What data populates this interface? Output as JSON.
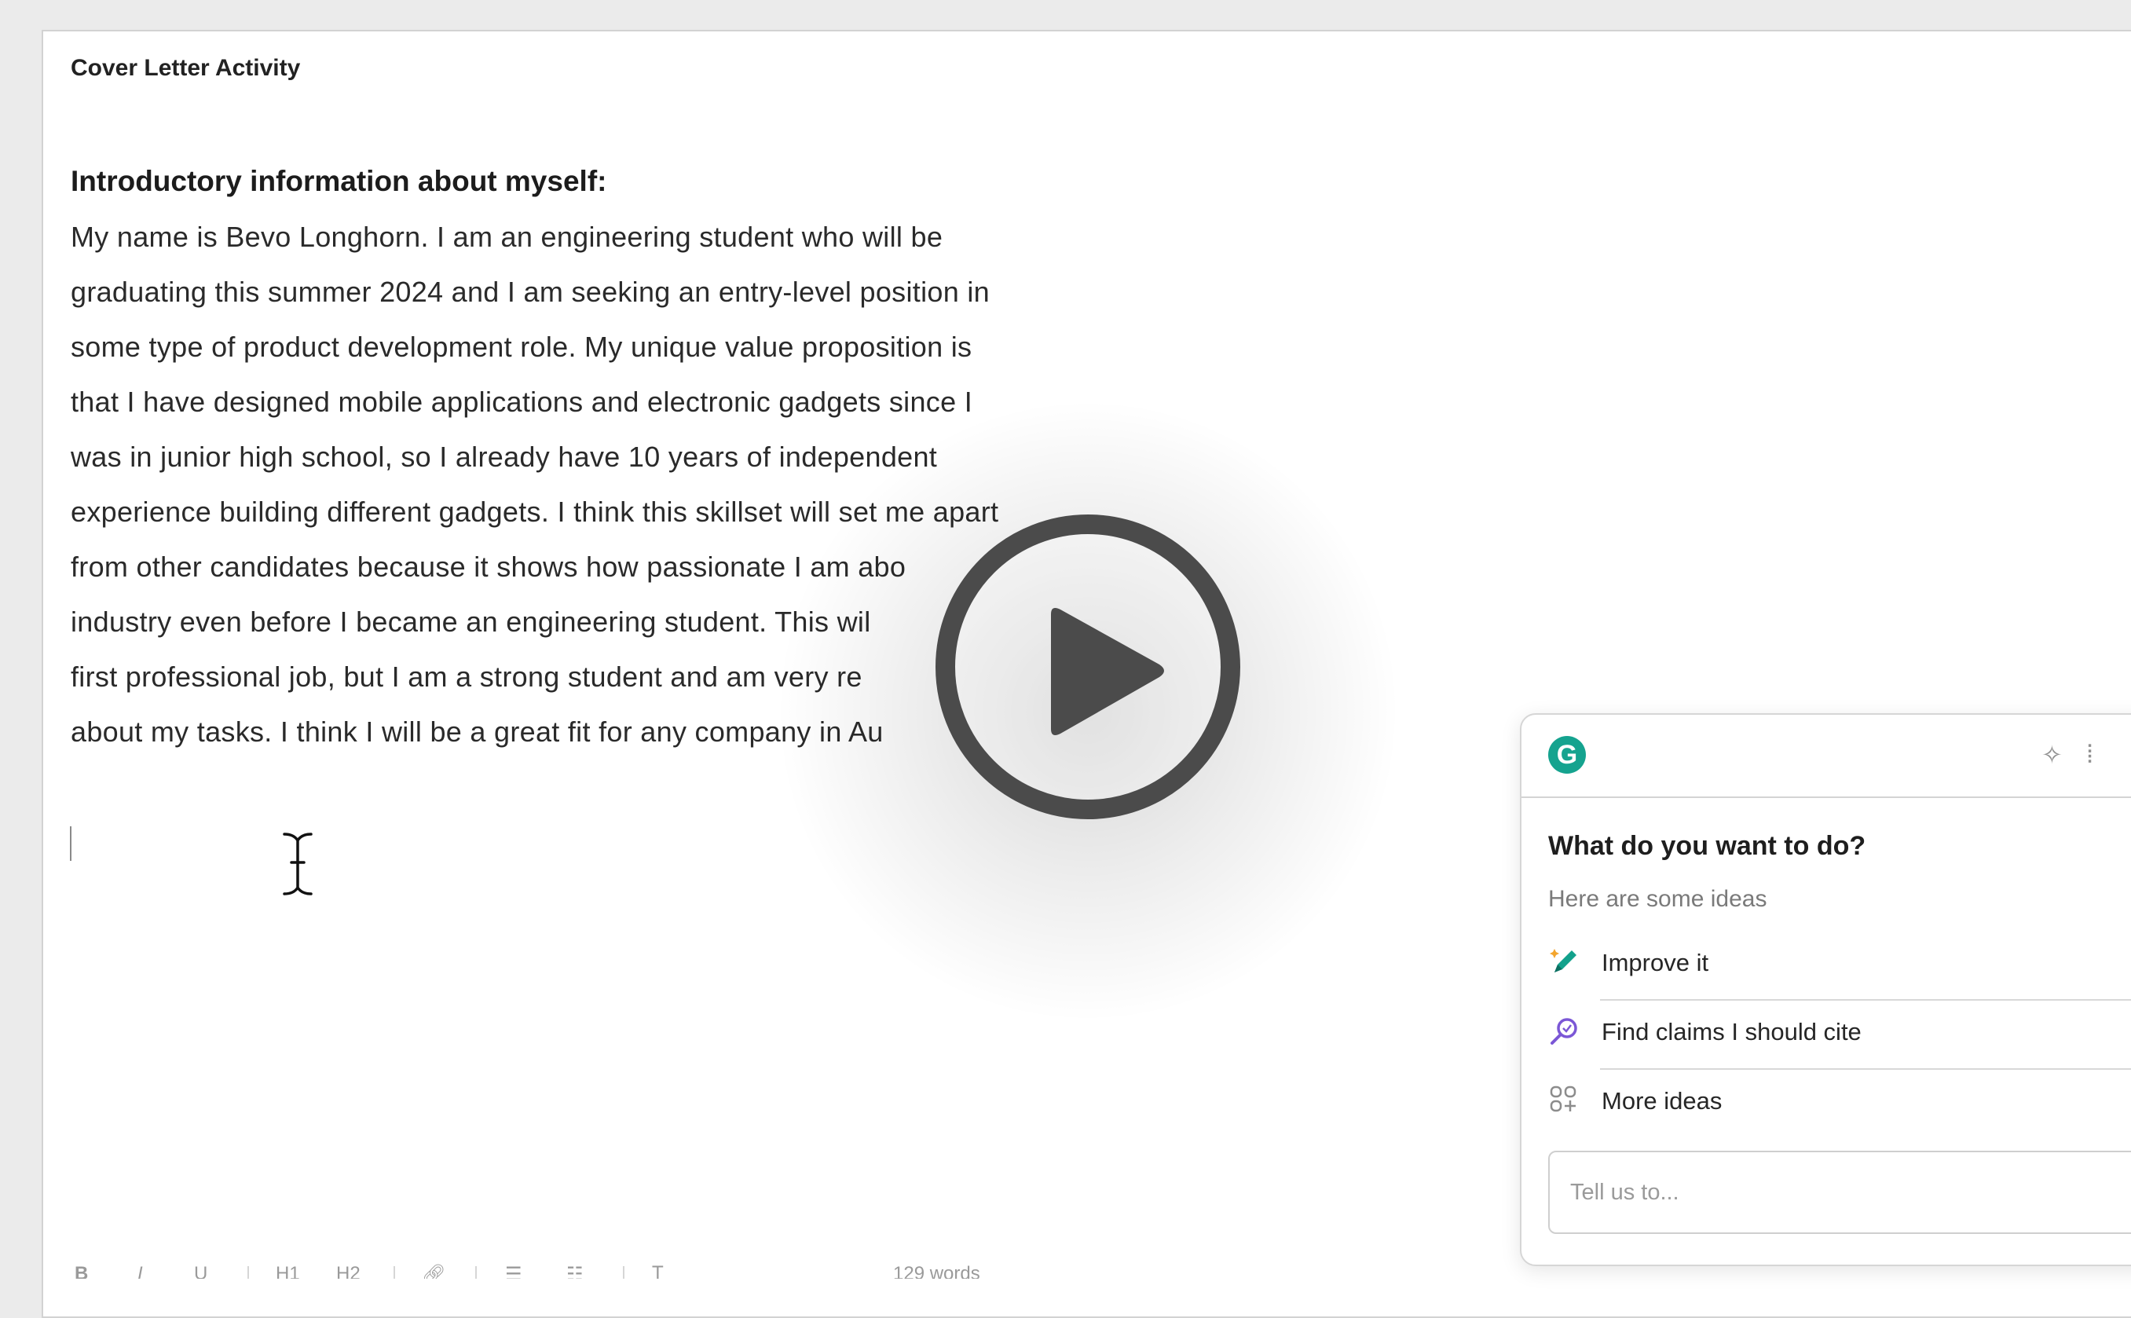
{
  "document": {
    "title": "Cover Letter Activity",
    "heading": "Introductory information about myself:",
    "lines": [
      "My name is Bevo Longhorn. I am an engineering student who will be",
      "graduating this summer 2024 and I am seeking an entry-level position in",
      "some type of product development role. My unique value proposition is",
      "that I have designed mobile applications and electronic gadgets since I",
      "was in junior high school, so I already have 10 years of independent",
      "experience building different gadgets. I think this skillset will set me apart",
      "from other candidates because it shows how passionate I am abo",
      "industry even before I became an engineering student. This wil",
      "first professional job, but I am a strong student and am very re",
      "about my tasks. I think I will be a great fit for any company in Au"
    ]
  },
  "video_overlay": {
    "icon": "play-icon"
  },
  "toolbar": {
    "bold": "B",
    "italic": "I",
    "underline": "U",
    "h1": "H1",
    "h2": "H2",
    "word_count": "129 words"
  },
  "assistant_panel": {
    "logo": "G",
    "question": "What do you want to do?",
    "subtitle": "Here are some ideas",
    "options": [
      {
        "label": "Improve it",
        "icon": "pencil-sparkle-icon"
      },
      {
        "label": "Find claims I should cite",
        "icon": "magnifier-icon"
      },
      {
        "label": "More ideas",
        "icon": "grid-plus-icon"
      }
    ],
    "input_placeholder": "Tell us to..."
  },
  "colors": {
    "brand": "#15a38f",
    "play_button": "#4b4b4b",
    "page_background": "#ebebeb"
  }
}
